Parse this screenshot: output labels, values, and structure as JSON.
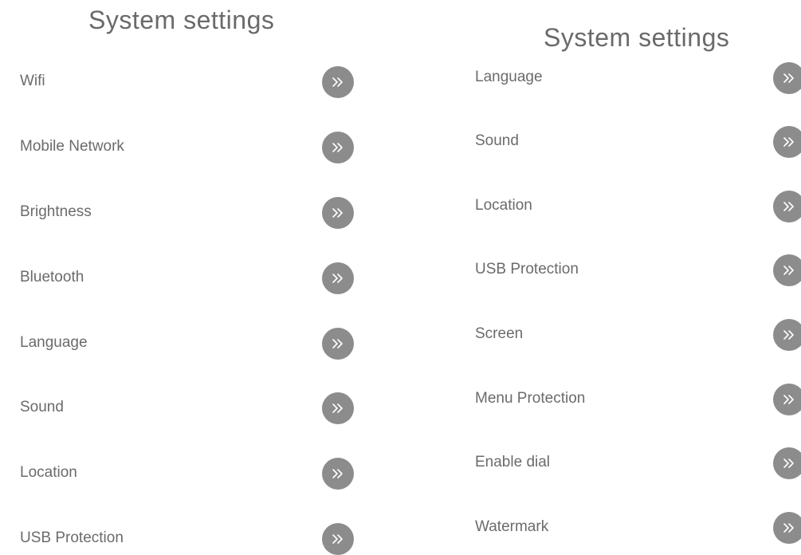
{
  "left_panel": {
    "title": "System settings",
    "items": [
      {
        "label": "Wifi"
      },
      {
        "label": "Mobile Network"
      },
      {
        "label": "Brightness"
      },
      {
        "label": "Bluetooth"
      },
      {
        "label": "Language"
      },
      {
        "label": "Sound"
      },
      {
        "label": "Location"
      },
      {
        "label": "USB Protection"
      }
    ]
  },
  "right_panel": {
    "title": "System settings",
    "items": [
      {
        "label": "Language"
      },
      {
        "label": "Sound"
      },
      {
        "label": "Location"
      },
      {
        "label": "USB Protection"
      },
      {
        "label": "Screen"
      },
      {
        "label": "Menu Protection"
      },
      {
        "label": "Enable dial"
      },
      {
        "label": "Watermark"
      }
    ]
  },
  "colors": {
    "text": "#6b6b6b",
    "button_bg": "#8c8c8c",
    "button_icon": "#ffffff",
    "background": "#ffffff"
  },
  "icons": {
    "row_action": "double-chevron-right-icon"
  }
}
